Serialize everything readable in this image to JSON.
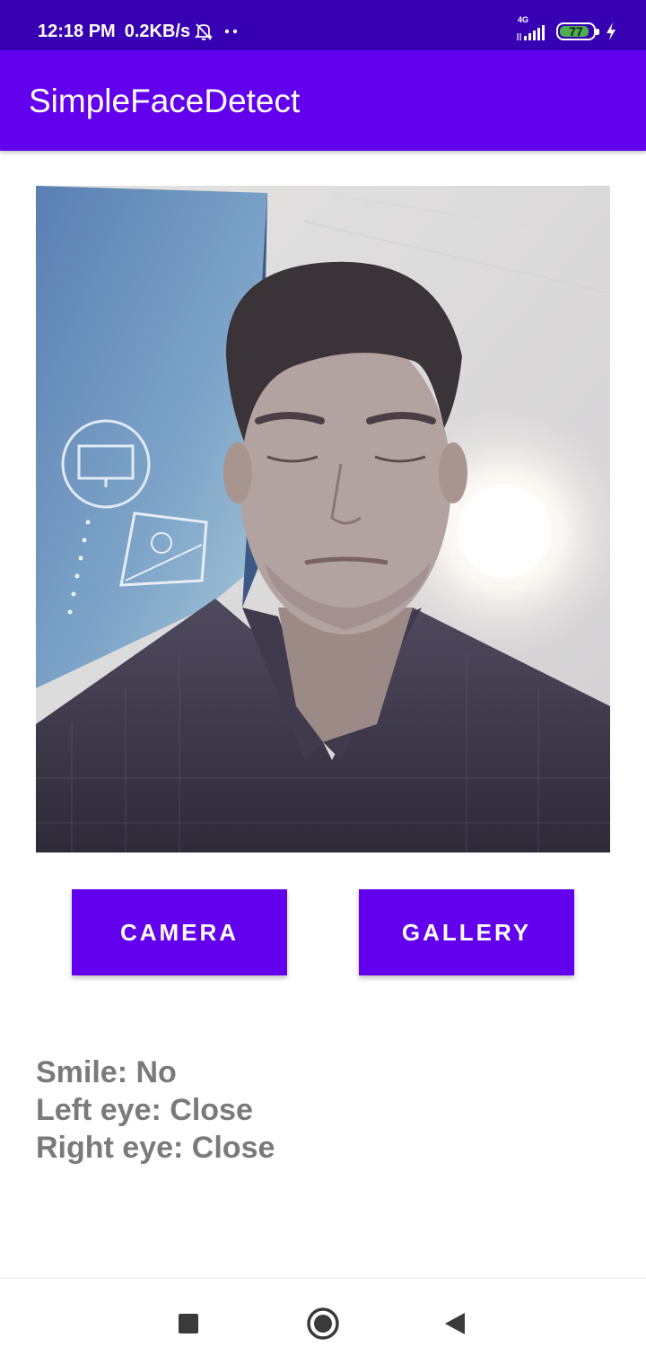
{
  "status_bar": {
    "time": "12:18 PM",
    "net_speed": "0.2KB/s",
    "network_type": "4G",
    "battery_level": "77",
    "icons": [
      "notifications-off-icon",
      "more-dots-icon",
      "signal-icon",
      "battery-icon",
      "charging-bolt-icon"
    ]
  },
  "app_bar": {
    "title": "SimpleFaceDetect"
  },
  "photo": {
    "icon": "face-photo"
  },
  "buttons": {
    "camera_label": "CAMERA",
    "gallery_label": "GALLERY"
  },
  "results": {
    "smile": "Smile: No",
    "left_eye": "Left eye: Close",
    "right_eye": "Right eye: Close"
  },
  "nav_bar": {
    "icons": [
      "recents-icon",
      "home-icon",
      "back-icon"
    ]
  },
  "colors": {
    "status_bar": "#3700b3",
    "primary": "#6200ee",
    "battery": "#4caf50",
    "result_text": "#7a7a7a"
  }
}
